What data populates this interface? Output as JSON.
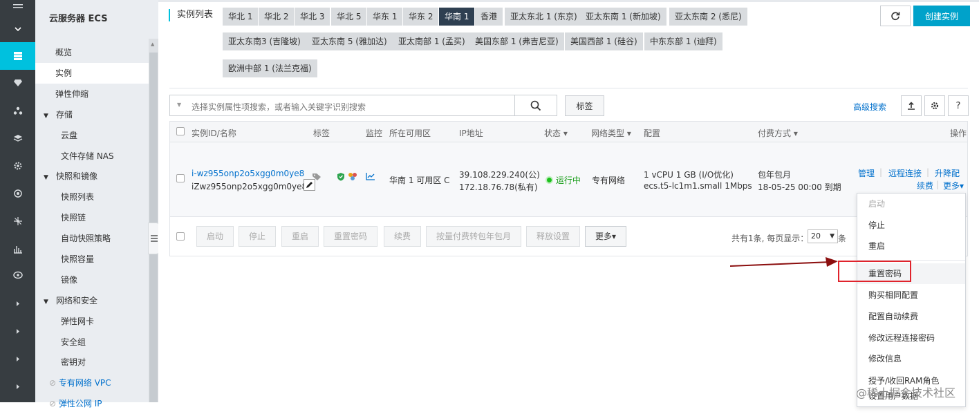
{
  "rail": {
    "items": [
      "menu-icon",
      "chevron-down-icon",
      "server-icon",
      "cloud-icon",
      "cluster-icon",
      "layers-icon",
      "gear-icon",
      "eye-icon",
      "network-icon",
      "chart-icon",
      "globe-icon",
      "chevron-right-icon",
      "chevron-right-icon",
      "chevron-right-icon",
      "chevron-right-icon"
    ]
  },
  "sidebar": {
    "title": "云服务器 ECS",
    "items": [
      {
        "label": "概览"
      },
      {
        "label": "实例"
      },
      {
        "label": "弹性伸缩"
      },
      {
        "label": "存储"
      },
      {
        "label": "云盘"
      },
      {
        "label": "文件存储 NAS"
      },
      {
        "label": "快照和镜像"
      },
      {
        "label": "快照列表"
      },
      {
        "label": "快照链"
      },
      {
        "label": "自动快照策略"
      },
      {
        "label": "快照容量"
      },
      {
        "label": "镜像"
      },
      {
        "label": "网络和安全"
      },
      {
        "label": "弹性网卡"
      },
      {
        "label": "安全组"
      },
      {
        "label": "密钥对"
      },
      {
        "label": "专有网络 VPC"
      },
      {
        "label": "弹性公网 IP"
      }
    ]
  },
  "header": {
    "title": "实例列表",
    "refresh_icon": "refresh-icon",
    "create_label": "创建实例",
    "regions": [
      "华北 1",
      "华北 2",
      "华北 3",
      "华北 5",
      "华东 1",
      "华东 2",
      "华南 1",
      "香港",
      "亚太东北 1 (东京)",
      "亚太东南 1 (新加坡)",
      "亚太东南 2 (悉尼)",
      "亚太东南3 (吉隆坡)",
      "亚太东南 5 (雅加达)",
      "亚太南部 1 (孟买)",
      "美国东部 1 (弗吉尼亚)",
      "美国西部 1 (硅谷)",
      "中东东部 1 (迪拜)",
      "欧洲中部 1 (法兰克福)"
    ],
    "active_region": "华南 1"
  },
  "search": {
    "placeholder": "选择实例属性项搜索，或者输入关键字识别搜索",
    "tag_label": "标签",
    "advanced_label": "高级搜索"
  },
  "table": {
    "columns": [
      "实例ID/名称",
      "标签",
      "监控",
      "所在可用区",
      "IP地址",
      "状态 ▾",
      "网络类型 ▾",
      "配置",
      "付费方式 ▾",
      "操作"
    ],
    "rows": [
      {
        "id": "i-wz955onp2o5xgg0m0ye8",
        "name": "iZwz955onp2o5xgg0m0ye8...",
        "zone": "华南 1 可用区 C",
        "ip_public": "39.108.229.240(公)",
        "ip_private": "172.18.76.78(私有)",
        "status": "运行中",
        "network": "专有网络",
        "config_line1": "1 vCPU 1 GB (I/O优化)",
        "config_line2": "ecs.t5-lc1m1.small   1Mbps",
        "billing_line1": "包年包月",
        "billing_line2": "18-05-25 00:00 到期",
        "actions": {
          "manage": "管理",
          "remote": "远程连接",
          "resize": "升降配",
          "renew": "续费",
          "more": "更多▾"
        }
      }
    ]
  },
  "bulk_actions": [
    "启动",
    "停止",
    "重启",
    "重置密码",
    "续费",
    "按量付费转包年包月",
    "释放设置",
    "更多▾"
  ],
  "pager": {
    "text": "共有1条, 每页显示：",
    "page_size": "20",
    "unit": "条"
  },
  "dropdown": {
    "items": [
      {
        "label": "启动",
        "disabled": true
      },
      {
        "label": "停止",
        "disabled": false
      },
      {
        "label": "重启",
        "disabled": false
      },
      {
        "label": "重置密码",
        "disabled": false
      },
      {
        "label": "购买相同配置",
        "disabled": false
      },
      {
        "label": "配置自动续费",
        "disabled": false
      },
      {
        "label": "修改远程连接密码",
        "disabled": false
      },
      {
        "label": "修改信息",
        "disabled": false
      },
      {
        "label": "授予/收回RAM角色",
        "disabled": false
      },
      {
        "label": "设置用户数据",
        "disabled": false
      }
    ]
  },
  "watermark": "@稀土掘金技术社区",
  "colors": {
    "rail": "#373d41",
    "rail_active": "#00c1de",
    "primary": "#00a2ca",
    "link": "#0070cc",
    "running": "#1dc11d",
    "highlight": "#e0232c",
    "arrow": "#8b0e0e"
  }
}
